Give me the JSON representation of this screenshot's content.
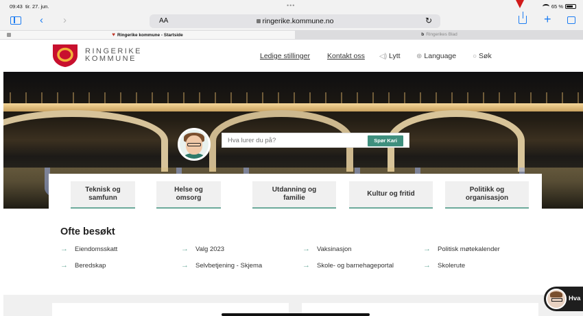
{
  "status_bar": {
    "time": "09:43",
    "date": "tir. 27. jun.",
    "battery": "65 %",
    "dots": "•••"
  },
  "browser": {
    "text_size": "AA",
    "url": "ringerike.kommune.no",
    "icons": [
      "sidebar-icon",
      "back-icon",
      "forward-icon",
      "lock-icon",
      "reload-icon",
      "share-icon",
      "plus-icon",
      "tabs-icon"
    ],
    "tabs": [
      {
        "label": "Ringerike kommune - Startside",
        "active": true
      },
      {
        "label": "Ringerikes Blad",
        "active": false
      }
    ],
    "back_glyph": "‹",
    "forward_glyph": "›",
    "plus_glyph": "+",
    "reload_glyph": "↻"
  },
  "header": {
    "logo_line1": "RINGERIKE",
    "logo_line2": "KOMMUNE",
    "nav": {
      "ledige": "Ledige stillinger",
      "kontakt": "Kontakt oss",
      "lytt": "Lytt",
      "language": "Language",
      "sok": "Søk"
    }
  },
  "hero": {
    "search_placeholder": "Hva lurer du på?",
    "search_button": "Spør Kari"
  },
  "categories": [
    "Teknisk og\nsamfunn",
    "Helse og\nomsorg",
    "Utdanning og\nfamilie",
    "Kultur og fritid",
    "Politikk og\norganisasjon"
  ],
  "ofte_besokt": {
    "title": "Ofte besøkt",
    "links": [
      "Eiendomsskatt",
      "Valg 2023",
      "Vaksinasjon",
      "Politisk møtekalender",
      "Beredskap",
      "Selvbetjening - Skjema",
      "Skole- og barnehageportal",
      "Skolerute"
    ]
  },
  "chat": {
    "label": "Hva"
  },
  "colors": {
    "brand_red": "#c8102e",
    "accent_green": "#3f8f7e",
    "ios_blue": "#1b7cf2"
  }
}
